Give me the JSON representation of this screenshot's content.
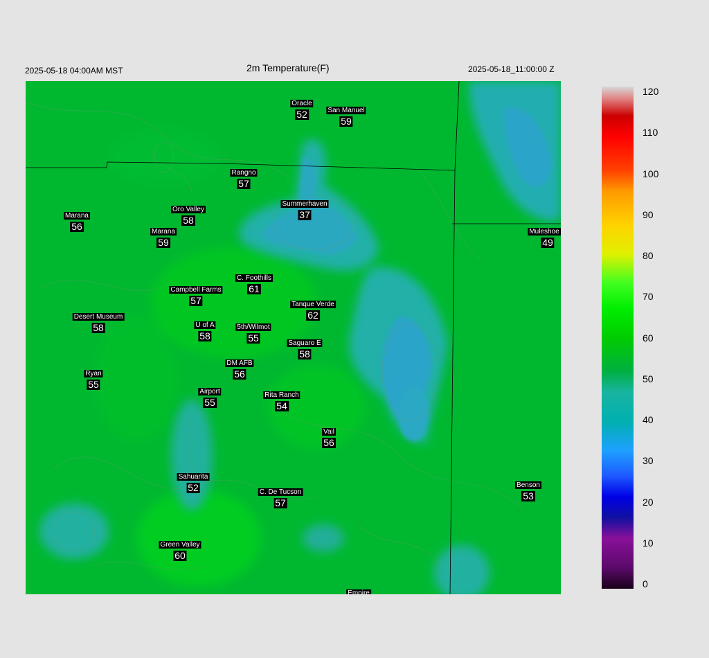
{
  "header": {
    "local_time": "2025-05-18 04:00AM MST",
    "title": "2m Temperature(F)",
    "utc_time": "2025-05-18_11:00:00 Z"
  },
  "stations": [
    {
      "name": "Oracle",
      "value": "52"
    },
    {
      "name": "San Manuel",
      "value": "59"
    },
    {
      "name": "Rangno",
      "value": "57"
    },
    {
      "name": "Summerhaven",
      "value": "37"
    },
    {
      "name": "Marana",
      "value": "56"
    },
    {
      "name": "Oro Valley",
      "value": "58"
    },
    {
      "name": "Marana",
      "value": "59"
    },
    {
      "name": "Muleshoe R",
      "value": "49"
    },
    {
      "name": "C. Foothills",
      "value": "61"
    },
    {
      "name": "Campbell Farms",
      "value": "57"
    },
    {
      "name": "Tanque Verde",
      "value": "62"
    },
    {
      "name": "Desert Museum",
      "value": "58"
    },
    {
      "name": "U of A",
      "value": "58"
    },
    {
      "name": "5th/Wilmot",
      "value": "55"
    },
    {
      "name": "Saguaro E",
      "value": "58"
    },
    {
      "name": "DM AFB",
      "value": "56"
    },
    {
      "name": "Ryan",
      "value": "55"
    },
    {
      "name": "Airport",
      "value": "55"
    },
    {
      "name": "Rita Ranch",
      "value": "54"
    },
    {
      "name": "Vail",
      "value": "56"
    },
    {
      "name": "Sahuarita",
      "value": "52"
    },
    {
      "name": "C. De Tucson",
      "value": "57"
    },
    {
      "name": "Benson",
      "value": "53"
    },
    {
      "name": "Green Valley",
      "value": "60"
    },
    {
      "name": "Empire",
      "value": ""
    }
  ],
  "colorbar": {
    "ticks": [
      "120",
      "110",
      "100",
      "90",
      "80",
      "70",
      "60",
      "50",
      "40",
      "30",
      "20",
      "10",
      "0"
    ],
    "min": 0,
    "max": 120,
    "stops": [
      {
        "v": 0,
        "color": "#1a001a"
      },
      {
        "v": 5,
        "color": "#5a0a6a"
      },
      {
        "v": 12,
        "color": "#8a109a"
      },
      {
        "v": 17,
        "color": "#1010a0"
      },
      {
        "v": 22,
        "color": "#0000e6"
      },
      {
        "v": 27,
        "color": "#1e5aff"
      },
      {
        "v": 33,
        "color": "#1ea0ff"
      },
      {
        "v": 40,
        "color": "#00b0b0"
      },
      {
        "v": 47,
        "color": "#18b4a0"
      },
      {
        "v": 52,
        "color": "#00b040"
      },
      {
        "v": 60,
        "color": "#00cc00"
      },
      {
        "v": 67,
        "color": "#00ee00"
      },
      {
        "v": 73,
        "color": "#40ff20"
      },
      {
        "v": 80,
        "color": "#e0f000"
      },
      {
        "v": 87,
        "color": "#ffd200"
      },
      {
        "v": 95,
        "color": "#ff9a00"
      },
      {
        "v": 100,
        "color": "#ff4000"
      },
      {
        "v": 108,
        "color": "#ff0000"
      },
      {
        "v": 113,
        "color": "#cc0000"
      },
      {
        "v": 117,
        "color": "#e08080"
      },
      {
        "v": 120,
        "color": "#d8d8d8"
      }
    ]
  },
  "colors": {
    "background": "#e4e4e4",
    "map_base": "#00b830",
    "map_warm": "#00cc22",
    "map_cool": "#20b0a0",
    "map_cold": "#28a8d0",
    "boundary": "#000000"
  }
}
